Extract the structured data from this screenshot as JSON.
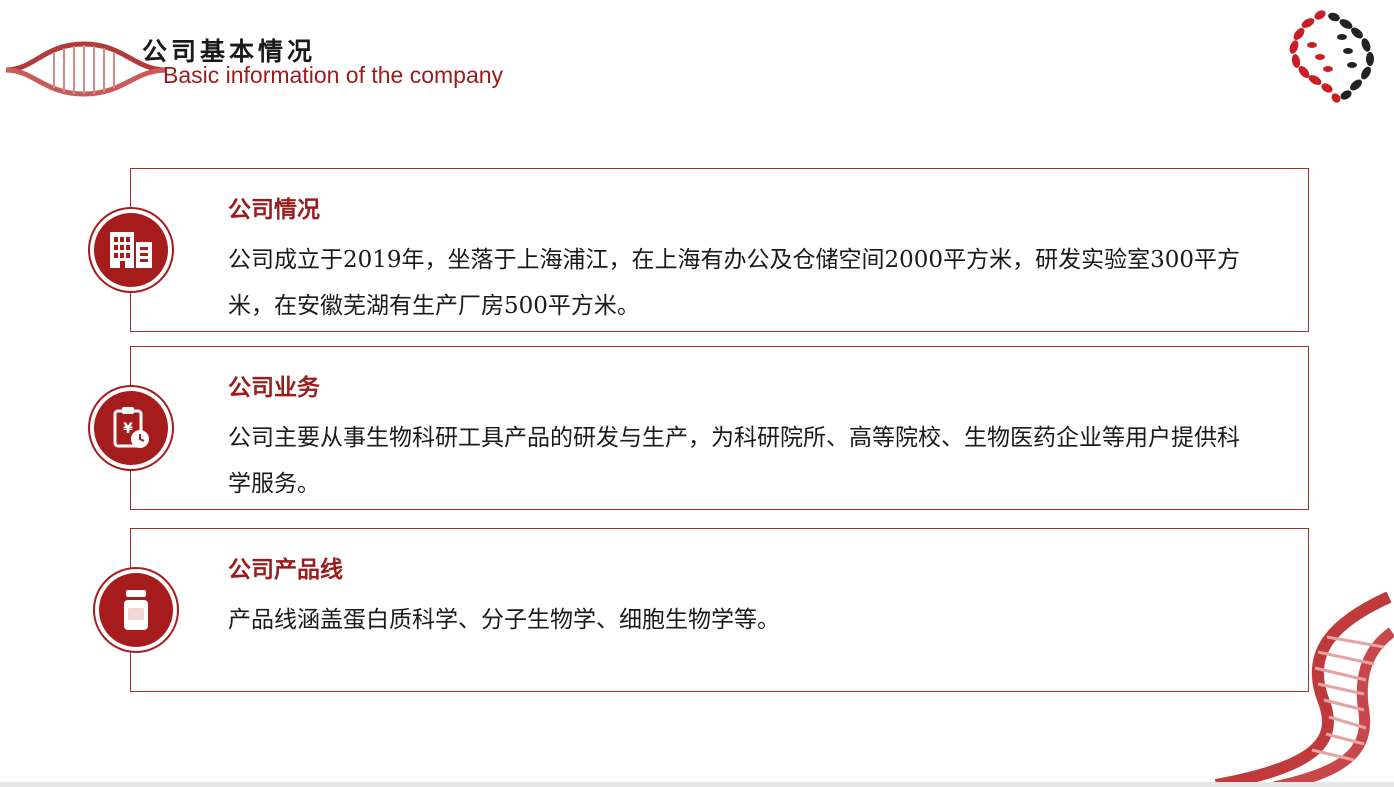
{
  "header": {
    "title_zh": "公司基本情况",
    "title_en": "Basic information of the company"
  },
  "colors": {
    "accent": "#a61c1c",
    "title_red": "#9b1c1c",
    "text": "#1a1a1a",
    "logo_black": "#222222"
  },
  "sections": [
    {
      "icon": "building-icon",
      "title": "公司情况",
      "text": "公司成立于2019年，坐落于上海浦江，在上海有办公及仓储空间2000平方米，研发实验室300平方米，在安徽芜湖有生产厂房500平方米。"
    },
    {
      "icon": "clipboard-yuan-clock-icon",
      "title": "公司业务",
      "text": "公司主要从事生物科研工具产品的研发与生产，为科研院所、高等院校、生物医药企业等用户提供科学服务。"
    },
    {
      "icon": "bottle-icon",
      "title": "公司产品线",
      "text": "产品线涵盖蛋白质科学、分子生物学、细胞生物学等。"
    }
  ]
}
